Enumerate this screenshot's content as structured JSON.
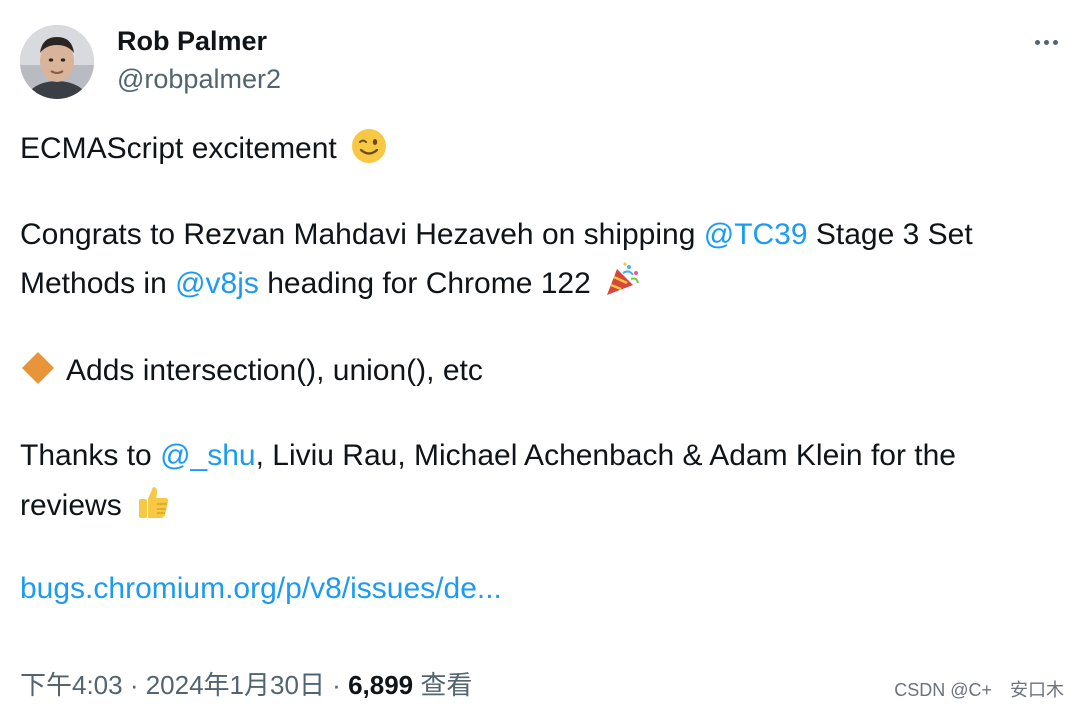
{
  "author": {
    "name": "Rob Palmer",
    "handle": "@robpalmer2"
  },
  "tweet": {
    "line1_text": "ECMAScript excitement",
    "line2_prefix": "Congrats to Rezvan Mahdavi Hezaveh on shipping ",
    "line2_mention": "@TC39",
    "line2_suffix": " Stage 3 Set",
    "line3_prefix": "Methods in ",
    "line3_mention": "@v8js",
    "line3_suffix": " heading for Chrome 122",
    "line4_text": "Adds intersection(), union(), etc",
    "line5_prefix": "Thanks to ",
    "line5_mention": "@_shu",
    "line5_suffix": ", Liviu Rau, Michael Achenbach & Adam Klein for the",
    "line6_text": "reviews",
    "link_text": "bugs.chromium.org/p/v8/issues/de..."
  },
  "meta": {
    "time": "下午4:03",
    "separator1": " · ",
    "date": "2024年1月30日",
    "separator2": " · ",
    "views_count": "6,899",
    "views_label": " 查看"
  },
  "watermark": "CSDN @C+　安口木",
  "icons": {
    "wink": "winking-face-emoji",
    "party": "party-popper-emoji",
    "diamond": "orange-diamond-emoji",
    "thumbs": "thumbs-up-emoji",
    "more": "more-icon"
  },
  "colors": {
    "mention": "#1d9bf0",
    "secondary_text": "#536471",
    "primary_text": "#0f1419",
    "diamond": "#e8953a",
    "emoji_yellow": "#f7c844"
  }
}
